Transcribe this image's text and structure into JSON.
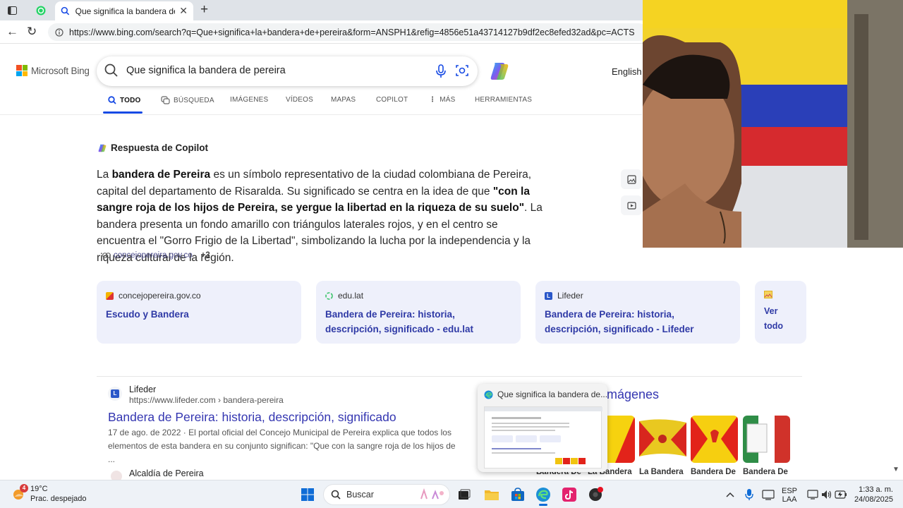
{
  "browser": {
    "tab_title": "Que significa la bandera de pereira",
    "url": "https://www.bing.com/search?q=Que+significa+la+bandera+de+pereira&form=ANSPH1&refig=4856e51a43714127b9df2ec8efed32ad&pc=ACTS"
  },
  "bing": {
    "logo_text": "Microsoft Bing",
    "query": "Que significa la bandera de pereira",
    "language": "English",
    "tabs": [
      "TODO",
      "BÚSQUEDA",
      "IMÁGENES",
      "VÍDEOS",
      "MAPAS",
      "COPILOT",
      "MÁS",
      "HERRAMIENTAS"
    ]
  },
  "copilot": {
    "heading": "Respuesta de Copilot",
    "p1": "La ",
    "b1": "bandera de Pereira",
    "p2": " es un símbolo representativo de la ciudad colombiana de Pereira, capital del departamento de Risaralda. Su significado se centra en la idea de que ",
    "b2": "\"con la sangre roja de los hijos de Pereira, se yergue la libertad en la riqueza de su suelo\"",
    "p3": ". La bandera presenta un fondo amarillo con triángulos laterales rojos, y en el centro se encuentra el \"Gorro Frigio de la Libertad\", simbolizando la lucha por la independencia y la riqueza cultural de la región.",
    "citation": "concejopereira.gov.co",
    "citation_more": "+3"
  },
  "cards": [
    {
      "source": "concejopereira.gov.co",
      "title": "Escudo y Bandera"
    },
    {
      "source": "edu.lat",
      "title": "Bandera de Pereira: historia, descripción, significado - edu.lat"
    },
    {
      "source": "Lifeder",
      "title": "Bandera de Pereira: historia, descripción, significado - Lifeder"
    }
  ],
  "see_all": "Ver todo",
  "result1": {
    "site": "Lifeder",
    "url": "https://www.lifeder.com › bandera-pereira",
    "title": "Bandera de Pereira: historia, descripción, significado",
    "snippet": "17 de ago. de 2022 · El portal oficial del Concejo Municipal de Pereira explica que todos los elementos de esta bandera en su conjunto significan: \"Que con la sangre roja de los hijos de ..."
  },
  "result2": {
    "site": "Alcaldía de Pereira"
  },
  "images": {
    "heading": "mágenes",
    "captions": [
      "Bandera De",
      "La Bandera",
      "La Bandera",
      "Bandera De",
      "Bandera De"
    ]
  },
  "preview": {
    "title": "Que significa la bandera de..."
  },
  "taskbar": {
    "temperature": "19°C",
    "condition": "Prac. despejado",
    "weather_badge": "4",
    "search_placeholder": "Buscar",
    "lang_line1": "ESP",
    "lang_line2": "LAA",
    "time": "1:33 a. m.",
    "date": "24/08/2025"
  }
}
